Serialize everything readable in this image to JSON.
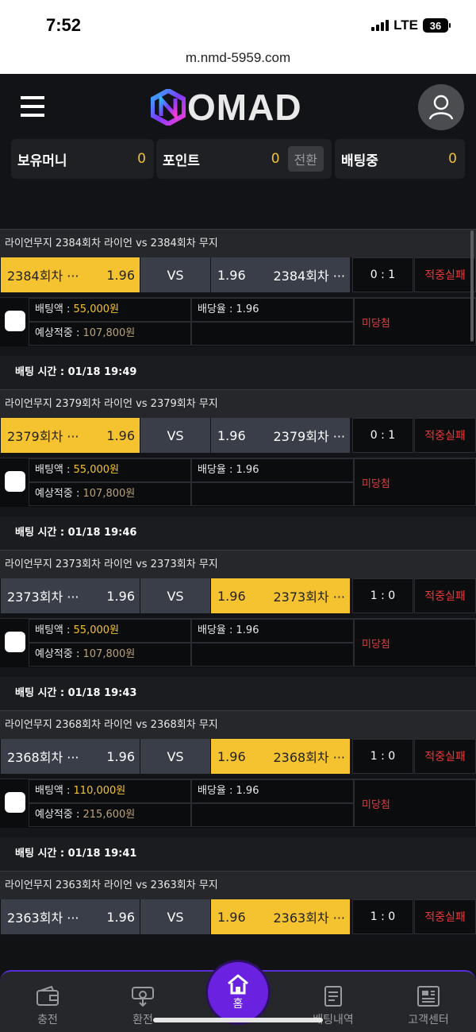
{
  "status_bar": {
    "time": "7:52",
    "network": "LTE",
    "battery": "36"
  },
  "browser": {
    "url": "m.nmd-5959.com"
  },
  "header": {
    "logo_text": "OMAD",
    "balances": [
      {
        "label": "보유머니",
        "value": "0"
      },
      {
        "label": "포인트",
        "value": "0",
        "button": "전환"
      },
      {
        "label": "배팅중",
        "value": "0"
      }
    ]
  },
  "bets": [
    {
      "time_label": "",
      "title": "라이언무지 2384회차 라이언  vs  2384회차 무지",
      "home_name": "2384회차 ···",
      "home_odds": "1.96",
      "vs": "VS",
      "away_odds": "1.96",
      "away_name": "2384회차 ···",
      "selected": "home",
      "score": "0 : 1",
      "result": "적중실패",
      "amount_label": "배팅액 : ",
      "amount": "55,000원",
      "odds_label": "배당율 : 1.96",
      "expected_label": "예상적중 : ",
      "expected": "107,800원",
      "payout": "미당첨"
    },
    {
      "time_label": "배팅 시간 : 01/18 19:49",
      "title": "라이언무지 2379회차 라이언  vs  2379회차 무지",
      "home_name": "2379회차 ···",
      "home_odds": "1.96",
      "vs": "VS",
      "away_odds": "1.96",
      "away_name": "2379회차 ···",
      "selected": "home",
      "score": "0 : 1",
      "result": "적중실패",
      "amount_label": "배팅액 : ",
      "amount": "55,000원",
      "odds_label": "배당율 : 1.96",
      "expected_label": "예상적중 : ",
      "expected": "107,800원",
      "payout": "미당첨"
    },
    {
      "time_label": "배팅 시간 : 01/18 19:46",
      "title": "라이언무지 2373회차 라이언  vs  2373회차 무지",
      "home_name": "2373회차 ···",
      "home_odds": "1.96",
      "vs": "VS",
      "away_odds": "1.96",
      "away_name": "2373회차 ···",
      "selected": "away",
      "score": "1 : 0",
      "result": "적중실패",
      "amount_label": "배팅액 : ",
      "amount": "55,000원",
      "odds_label": "배당율 : 1.96",
      "expected_label": "예상적중 : ",
      "expected": "107,800원",
      "payout": "미당첨"
    },
    {
      "time_label": "배팅 시간 : 01/18 19:43",
      "title": "라이언무지 2368회차 라이언  vs  2368회차 무지",
      "home_name": "2368회차 ···",
      "home_odds": "1.96",
      "vs": "VS",
      "away_odds": "1.96",
      "away_name": "2368회차 ···",
      "selected": "away",
      "score": "1 : 0",
      "result": "적중실패",
      "amount_label": "배팅액 : ",
      "amount": "110,000원",
      "odds_label": "배당율 : 1.96",
      "expected_label": "예상적중 : ",
      "expected": "215,600원",
      "payout": "미당첨"
    },
    {
      "time_label": "배팅 시간 : 01/18 19:41",
      "title": "라이언무지 2363회차 라이언  vs  2363회차 무지",
      "home_name": "2363회차 ···",
      "home_odds": "1.96",
      "vs": "VS",
      "away_odds": "1.96",
      "away_name": "2363회차 ···",
      "selected": "away",
      "score": "1 : 0",
      "result": "적중실패"
    }
  ],
  "bottom_nav": {
    "items": [
      {
        "label": "충전",
        "icon": "wallet-icon"
      },
      {
        "label": "환전",
        "icon": "withdraw-icon"
      },
      {
        "label": "홈",
        "icon": "home-icon"
      },
      {
        "label": "배팅내역",
        "icon": "document-icon"
      },
      {
        "label": "고객센터",
        "icon": "news-icon"
      }
    ]
  },
  "colors": {
    "accent": "#f5c230",
    "nav_highlight": "#6a22e0",
    "loss_red": "#e83a3a"
  }
}
